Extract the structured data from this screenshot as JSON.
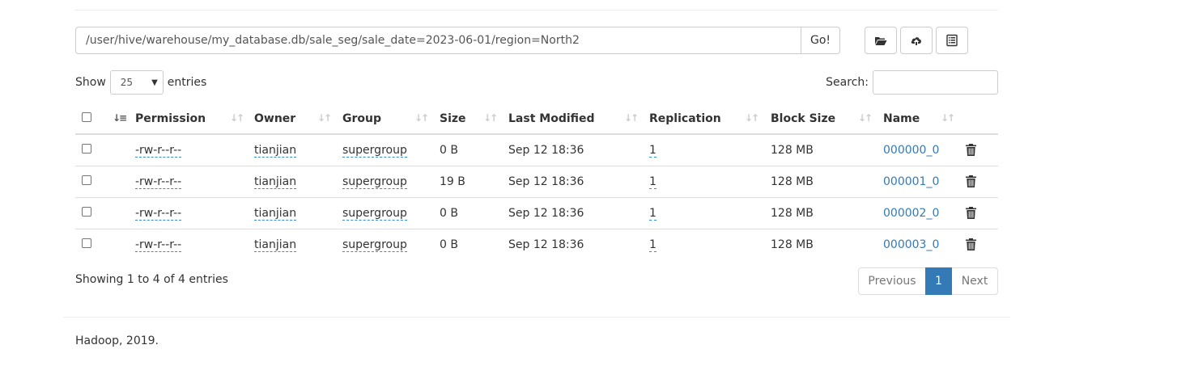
{
  "path_bar": {
    "value": "/user/hive/warehouse/my_database.db/sale_seg/sale_date=2023-06-01/region=North2",
    "go_label": "Go!"
  },
  "toolbar": {
    "icons": [
      "folder-open-icon",
      "cloud-upload-icon",
      "list-alt-icon"
    ]
  },
  "length": {
    "show_label": "Show",
    "selected": "25",
    "entries_label": "entries"
  },
  "search": {
    "label": "Search:",
    "value": ""
  },
  "table": {
    "headers": {
      "permission": "Permission",
      "owner": "Owner",
      "group": "Group",
      "size": "Size",
      "last_modified": "Last Modified",
      "replication": "Replication",
      "block_size": "Block Size",
      "name": "Name"
    },
    "rows": [
      {
        "permission": "-rw-r--r--",
        "owner": "tianjian",
        "group": "supergroup",
        "size": "0 B",
        "last_modified": "Sep 12 18:36",
        "replication": "1",
        "block_size": "128 MB",
        "name": "000000_0"
      },
      {
        "permission": "-rw-r--r--",
        "owner": "tianjian",
        "group": "supergroup",
        "size": "19 B",
        "last_modified": "Sep 12 18:36",
        "replication": "1",
        "block_size": "128 MB",
        "name": "000001_0"
      },
      {
        "permission": "-rw-r--r--",
        "owner": "tianjian",
        "group": "supergroup",
        "size": "0 B",
        "last_modified": "Sep 12 18:36",
        "replication": "1",
        "block_size": "128 MB",
        "name": "000002_0"
      },
      {
        "permission": "-rw-r--r--",
        "owner": "tianjian",
        "group": "supergroup",
        "size": "0 B",
        "last_modified": "Sep 12 18:36",
        "replication": "1",
        "block_size": "128 MB",
        "name": "000003_0"
      }
    ]
  },
  "info": "Showing 1 to 4 of 4 entries",
  "pagination": {
    "previous": "Previous",
    "current": "1",
    "next": "Next"
  },
  "footer": "Hadoop, 2019.",
  "colors": {
    "link": "#337ab7",
    "active_page": "#337ab7",
    "border": "#dddddd"
  }
}
